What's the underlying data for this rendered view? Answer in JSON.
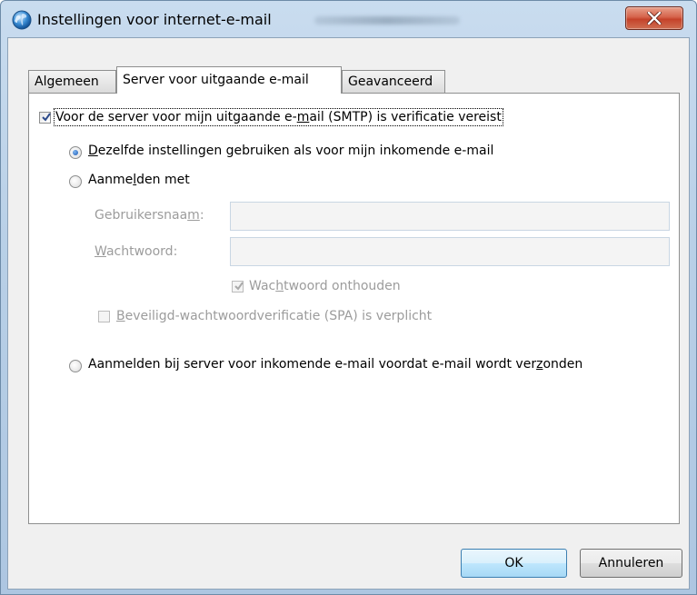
{
  "window": {
    "title": "Instellingen voor internet-e-mail"
  },
  "tabs": [
    {
      "label": "Algemeen",
      "active": false
    },
    {
      "label": "Server voor uitgaande e-mail",
      "active": true
    },
    {
      "label": "Geavanceerd",
      "active": false
    }
  ],
  "smtp_auth": {
    "label_pre": "Voor de server voor mijn uitgaande e-",
    "label_mnemonic": "m",
    "label_post": "ail (SMTP) is verificatie vereist",
    "checked": true
  },
  "option_same_settings": {
    "label_mnemonic": "D",
    "label_post": "ezelfde instellingen gebruiken als voor mijn inkomende e-mail",
    "selected": true
  },
  "option_login_with": {
    "label_pre": "Aanme",
    "label_mnemonic": "l",
    "label_post": "den met",
    "selected": false
  },
  "username": {
    "label_pre": "Gebruikersnaa",
    "label_mnemonic": "m",
    "label_post": ":",
    "value": ""
  },
  "password": {
    "label_mnemonic": "W",
    "label_post": "achtwoord:",
    "value": ""
  },
  "remember_password": {
    "label_pre": "Wac",
    "label_mnemonic": "h",
    "label_post": "twoord onthouden",
    "checked": true
  },
  "spa": {
    "label_mnemonic": "B",
    "label_post": "eveiligd-wachtwoordverificatie (SPA) is verplicht",
    "checked": false
  },
  "option_login_incoming": {
    "label_pre": "Aanmelden bij server voor inkomende e-mail voordat e-mail wordt ver",
    "label_mnemonic": "z",
    "label_post": "onden",
    "selected": false
  },
  "buttons": {
    "ok": "OK",
    "cancel": "Annuleren"
  },
  "colors": {
    "close_button": "#c9442b",
    "radio_selected": "#1b59b5",
    "default_button_border": "#3c7fb1",
    "disabled_text": "#9c9c9c"
  },
  "icons": {
    "app": "outlook-globe-icon",
    "close": "close-icon",
    "checkmark": "checkmark-icon",
    "radio_dot": "radio-dot-icon"
  }
}
